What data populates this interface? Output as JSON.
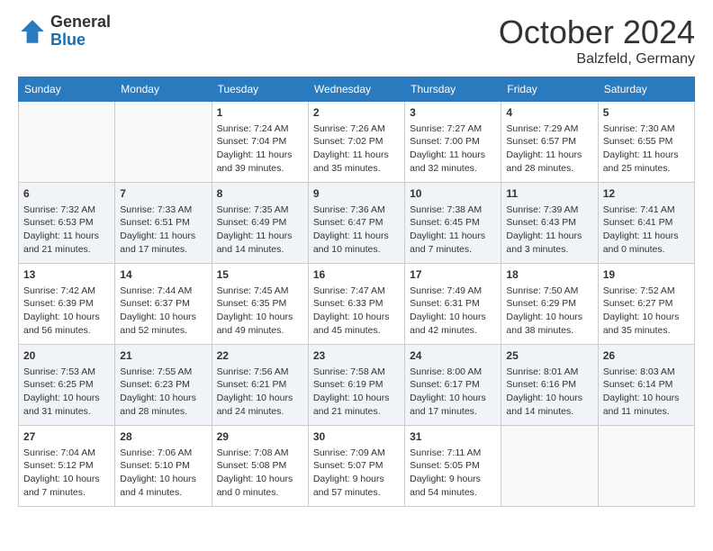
{
  "header": {
    "logo_general": "General",
    "logo_blue": "Blue",
    "month_year": "October 2024",
    "location": "Balzfeld, Germany"
  },
  "weekdays": [
    "Sunday",
    "Monday",
    "Tuesday",
    "Wednesday",
    "Thursday",
    "Friday",
    "Saturday"
  ],
  "weeks": [
    [
      {
        "day": "",
        "content": ""
      },
      {
        "day": "",
        "content": ""
      },
      {
        "day": "1",
        "content": "Sunrise: 7:24 AM\nSunset: 7:04 PM\nDaylight: 11 hours and 39 minutes."
      },
      {
        "day": "2",
        "content": "Sunrise: 7:26 AM\nSunset: 7:02 PM\nDaylight: 11 hours and 35 minutes."
      },
      {
        "day": "3",
        "content": "Sunrise: 7:27 AM\nSunset: 7:00 PM\nDaylight: 11 hours and 32 minutes."
      },
      {
        "day": "4",
        "content": "Sunrise: 7:29 AM\nSunset: 6:57 PM\nDaylight: 11 hours and 28 minutes."
      },
      {
        "day": "5",
        "content": "Sunrise: 7:30 AM\nSunset: 6:55 PM\nDaylight: 11 hours and 25 minutes."
      }
    ],
    [
      {
        "day": "6",
        "content": "Sunrise: 7:32 AM\nSunset: 6:53 PM\nDaylight: 11 hours and 21 minutes."
      },
      {
        "day": "7",
        "content": "Sunrise: 7:33 AM\nSunset: 6:51 PM\nDaylight: 11 hours and 17 minutes."
      },
      {
        "day": "8",
        "content": "Sunrise: 7:35 AM\nSunset: 6:49 PM\nDaylight: 11 hours and 14 minutes."
      },
      {
        "day": "9",
        "content": "Sunrise: 7:36 AM\nSunset: 6:47 PM\nDaylight: 11 hours and 10 minutes."
      },
      {
        "day": "10",
        "content": "Sunrise: 7:38 AM\nSunset: 6:45 PM\nDaylight: 11 hours and 7 minutes."
      },
      {
        "day": "11",
        "content": "Sunrise: 7:39 AM\nSunset: 6:43 PM\nDaylight: 11 hours and 3 minutes."
      },
      {
        "day": "12",
        "content": "Sunrise: 7:41 AM\nSunset: 6:41 PM\nDaylight: 11 hours and 0 minutes."
      }
    ],
    [
      {
        "day": "13",
        "content": "Sunrise: 7:42 AM\nSunset: 6:39 PM\nDaylight: 10 hours and 56 minutes."
      },
      {
        "day": "14",
        "content": "Sunrise: 7:44 AM\nSunset: 6:37 PM\nDaylight: 10 hours and 52 minutes."
      },
      {
        "day": "15",
        "content": "Sunrise: 7:45 AM\nSunset: 6:35 PM\nDaylight: 10 hours and 49 minutes."
      },
      {
        "day": "16",
        "content": "Sunrise: 7:47 AM\nSunset: 6:33 PM\nDaylight: 10 hours and 45 minutes."
      },
      {
        "day": "17",
        "content": "Sunrise: 7:49 AM\nSunset: 6:31 PM\nDaylight: 10 hours and 42 minutes."
      },
      {
        "day": "18",
        "content": "Sunrise: 7:50 AM\nSunset: 6:29 PM\nDaylight: 10 hours and 38 minutes."
      },
      {
        "day": "19",
        "content": "Sunrise: 7:52 AM\nSunset: 6:27 PM\nDaylight: 10 hours and 35 minutes."
      }
    ],
    [
      {
        "day": "20",
        "content": "Sunrise: 7:53 AM\nSunset: 6:25 PM\nDaylight: 10 hours and 31 minutes."
      },
      {
        "day": "21",
        "content": "Sunrise: 7:55 AM\nSunset: 6:23 PM\nDaylight: 10 hours and 28 minutes."
      },
      {
        "day": "22",
        "content": "Sunrise: 7:56 AM\nSunset: 6:21 PM\nDaylight: 10 hours and 24 minutes."
      },
      {
        "day": "23",
        "content": "Sunrise: 7:58 AM\nSunset: 6:19 PM\nDaylight: 10 hours and 21 minutes."
      },
      {
        "day": "24",
        "content": "Sunrise: 8:00 AM\nSunset: 6:17 PM\nDaylight: 10 hours and 17 minutes."
      },
      {
        "day": "25",
        "content": "Sunrise: 8:01 AM\nSunset: 6:16 PM\nDaylight: 10 hours and 14 minutes."
      },
      {
        "day": "26",
        "content": "Sunrise: 8:03 AM\nSunset: 6:14 PM\nDaylight: 10 hours and 11 minutes."
      }
    ],
    [
      {
        "day": "27",
        "content": "Sunrise: 7:04 AM\nSunset: 5:12 PM\nDaylight: 10 hours and 7 minutes."
      },
      {
        "day": "28",
        "content": "Sunrise: 7:06 AM\nSunset: 5:10 PM\nDaylight: 10 hours and 4 minutes."
      },
      {
        "day": "29",
        "content": "Sunrise: 7:08 AM\nSunset: 5:08 PM\nDaylight: 10 hours and 0 minutes."
      },
      {
        "day": "30",
        "content": "Sunrise: 7:09 AM\nSunset: 5:07 PM\nDaylight: 9 hours and 57 minutes."
      },
      {
        "day": "31",
        "content": "Sunrise: 7:11 AM\nSunset: 5:05 PM\nDaylight: 9 hours and 54 minutes."
      },
      {
        "day": "",
        "content": ""
      },
      {
        "day": "",
        "content": ""
      }
    ]
  ]
}
